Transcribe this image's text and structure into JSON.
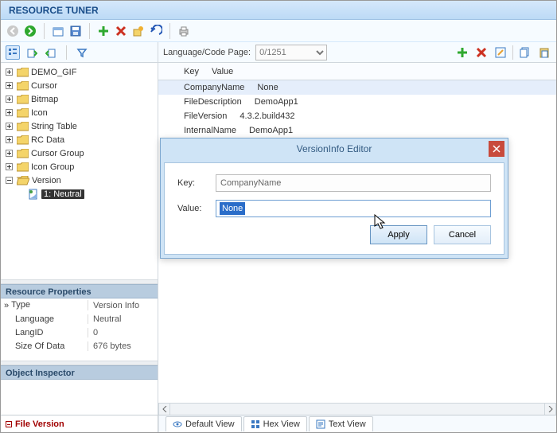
{
  "app_title": "RESOURCE TUNER",
  "tree": [
    {
      "label": "DEMO_GIF"
    },
    {
      "label": "Cursor"
    },
    {
      "label": "Bitmap"
    },
    {
      "label": "Icon"
    },
    {
      "label": "String Table"
    },
    {
      "label": "RC Data"
    },
    {
      "label": "Cursor Group"
    },
    {
      "label": "Icon Group"
    },
    {
      "label": "Version",
      "open": true,
      "children": [
        {
          "label": "1: Neutral",
          "selected": true
        }
      ]
    }
  ],
  "props_header": "Resource Properties",
  "props": {
    "type_label": "Type",
    "type_value": "Version Info",
    "language_label": "Language",
    "language_value": "Neutral",
    "langid_label": "LangID",
    "langid_value": "0",
    "size_label": "Size Of Data",
    "size_value": "676 bytes"
  },
  "objinsp_header": "Object Inspector",
  "file_version_tab": "File Version",
  "langbar": {
    "label": "Language/Code Page:",
    "value": "0/1251"
  },
  "kv": {
    "key_header": "Key",
    "value_header": "Value",
    "rows": [
      {
        "key": "CompanyName",
        "value": "None",
        "selected": true
      },
      {
        "key": "FileDescription",
        "value": "DemoApp1"
      },
      {
        "key": "FileVersion",
        "value": "4.3.2.build432"
      },
      {
        "key": "InternalName",
        "value": "DemoApp1"
      }
    ]
  },
  "dialog": {
    "title": "VersionInfo Editor",
    "key_label": "Key:",
    "key_value": "CompanyName",
    "value_label": "Value:",
    "value_value": "None",
    "apply": "Apply",
    "cancel": "Cancel"
  },
  "viewtabs": {
    "default": "Default View",
    "hex": "Hex View",
    "text": "Text View"
  }
}
